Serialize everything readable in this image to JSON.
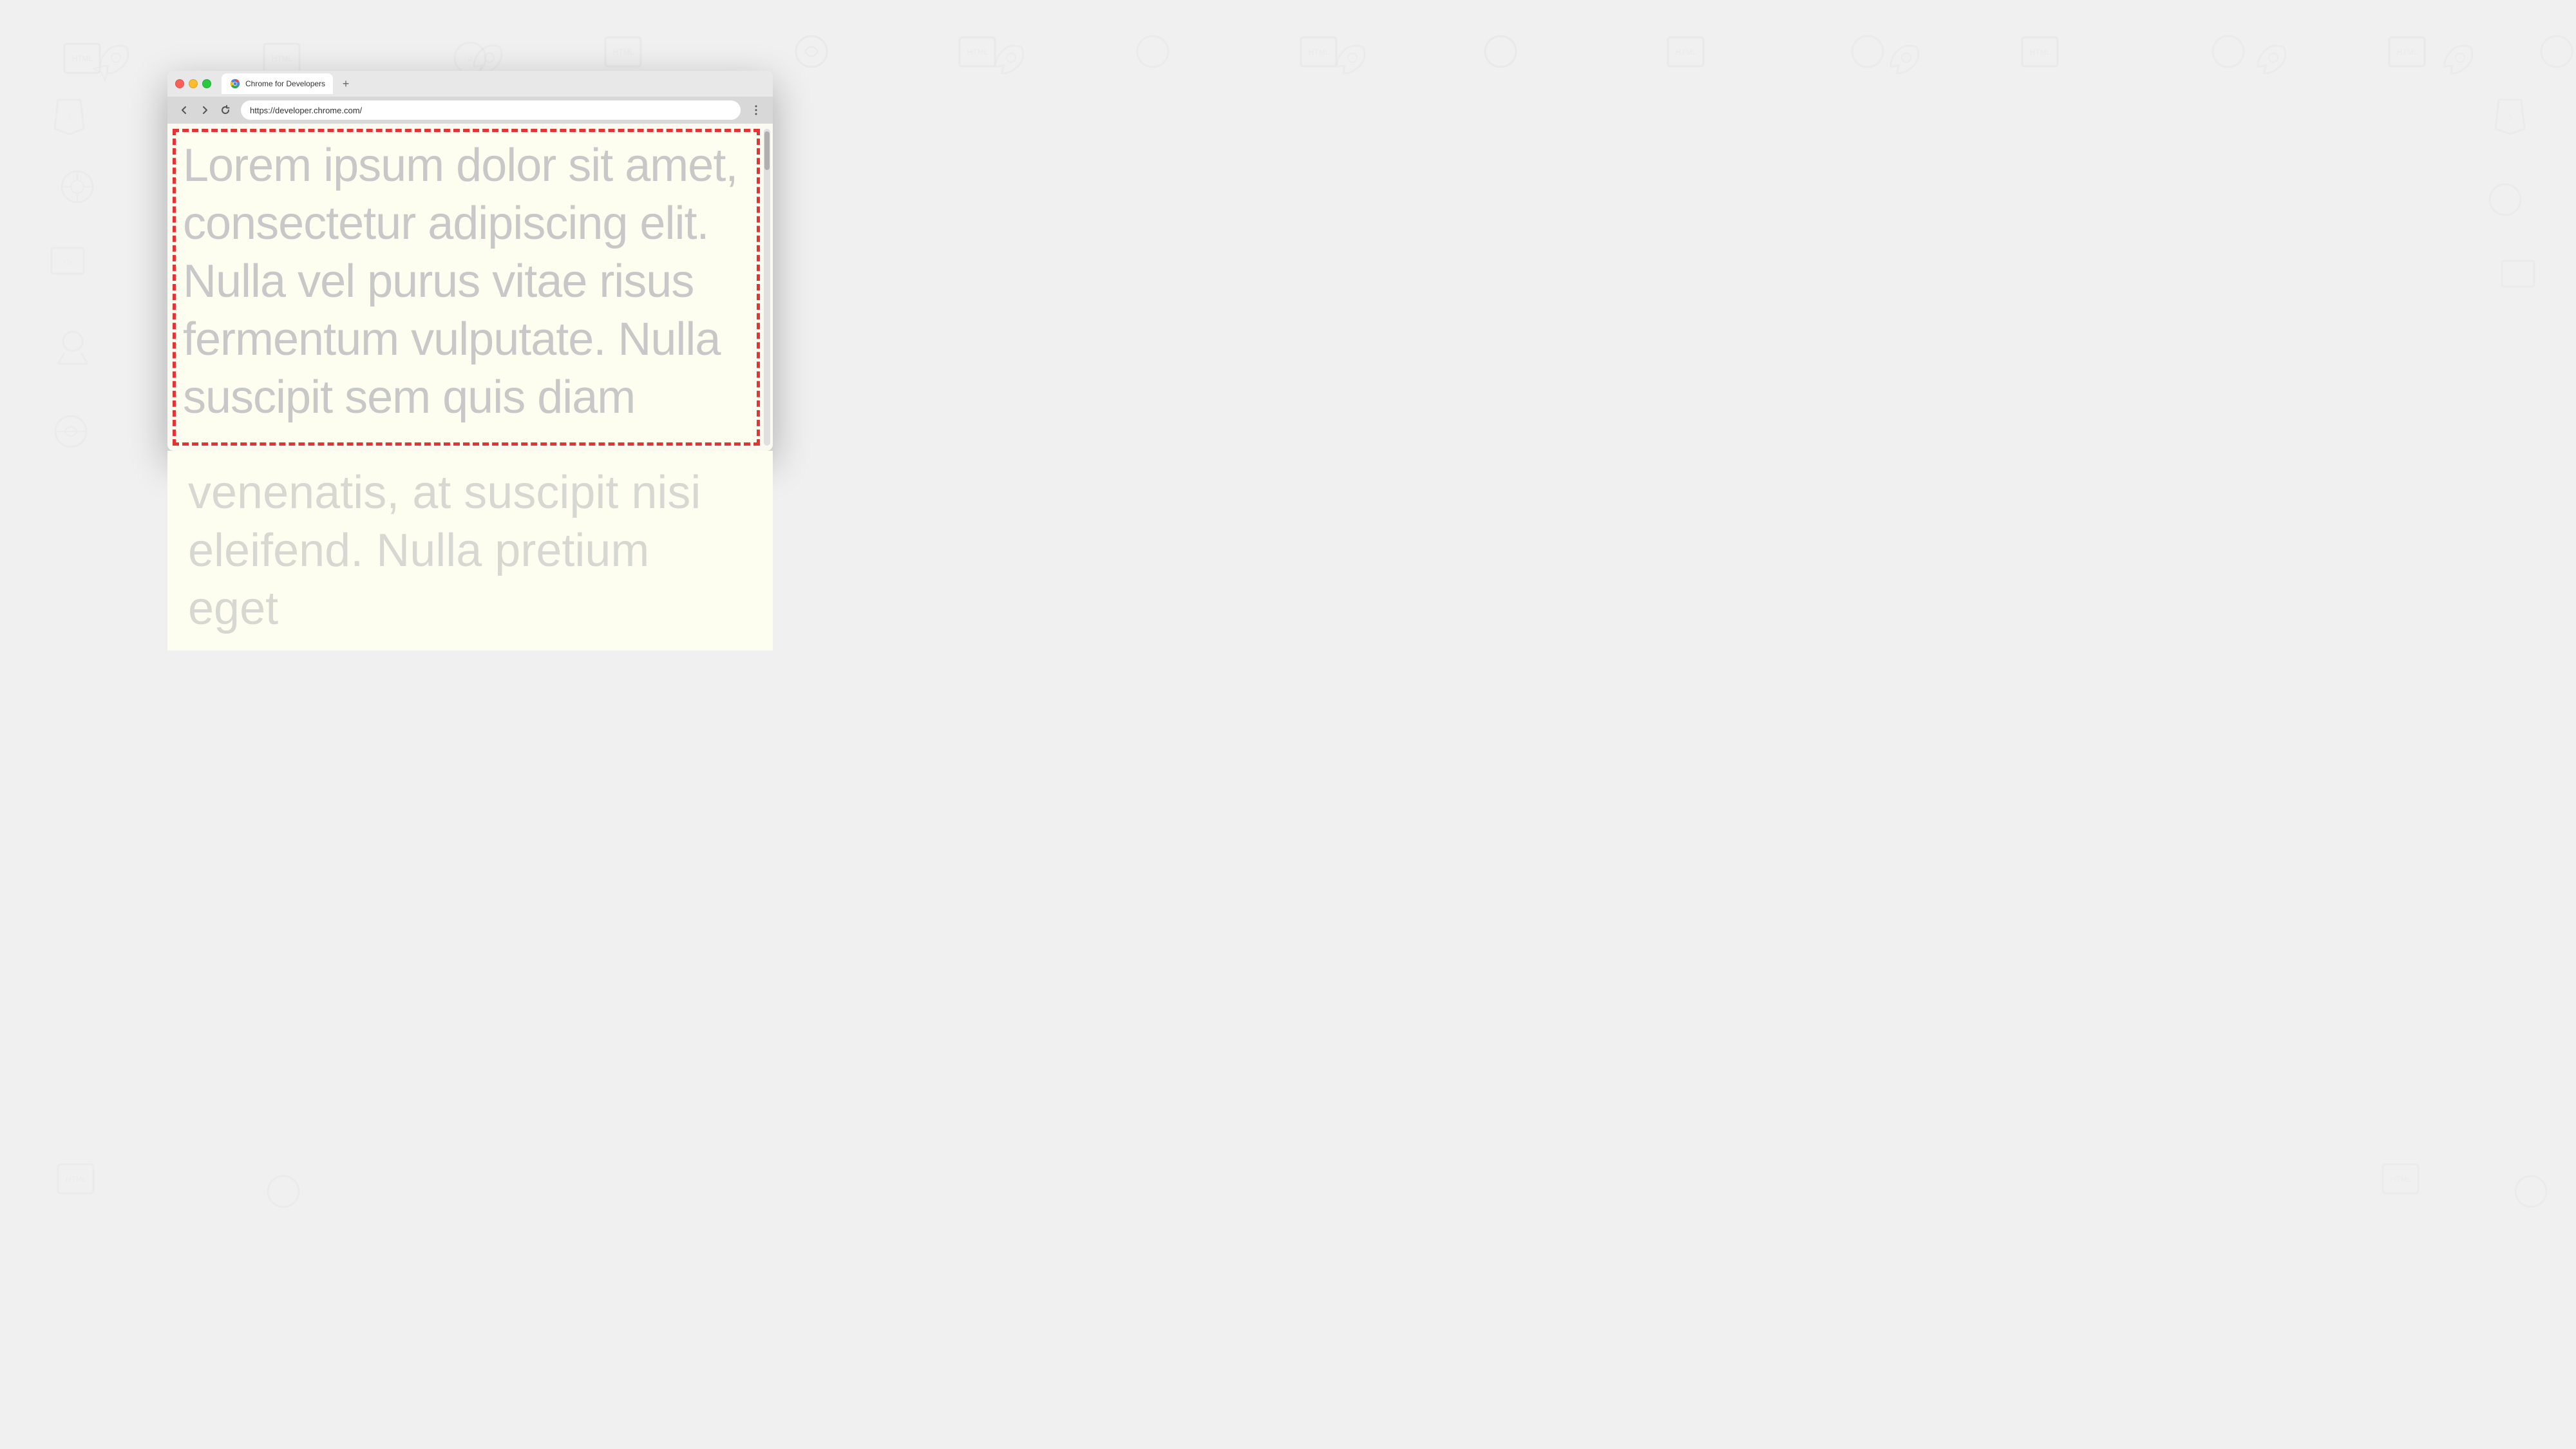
{
  "browser": {
    "tab": {
      "title": "Chrome for Developers",
      "favicon": "chrome-logo"
    },
    "new_tab_label": "+",
    "url": "https://developer.chrome.com/",
    "nav": {
      "back_label": "←",
      "forward_label": "→",
      "refresh_label": "↺"
    },
    "menu_label": "⋮"
  },
  "page": {
    "lorem_text": "Lorem ipsum dolor sit amet, consectetur adipiscing elit. Nulla vel purus vitae risus fermentum vulputate. Nulla suscipit sem quis diam venenatis, at suscipit nisi eleifend. Nulla pretium eget",
    "border_color": "#e53333",
    "bg_color": "#fefef0",
    "text_color": "#c8c8d8"
  },
  "traffic_lights": {
    "close_color": "#ff5f57",
    "minimize_color": "#ffbd2e",
    "maximize_color": "#28ca41"
  }
}
